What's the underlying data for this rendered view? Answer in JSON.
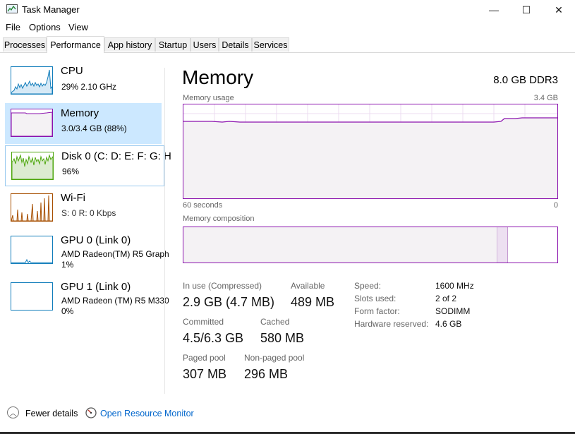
{
  "window": {
    "title": "Task Manager",
    "controls": {
      "minimize": "—",
      "maximize": "☐",
      "close": "✕"
    }
  },
  "menu": [
    "File",
    "Options",
    "View"
  ],
  "tabs": [
    "Processes",
    "Performance",
    "App history",
    "Startup",
    "Users",
    "Details",
    "Services"
  ],
  "active_tab": "Performance",
  "sidebar": {
    "items": [
      {
        "title": "CPU",
        "line1": "29%  2.10 GHz",
        "line2": "",
        "color": "#117dbb"
      },
      {
        "title": "Memory",
        "line1": "3.0/3.4 GB (88%)",
        "line2": "",
        "color": "#8b12ae"
      },
      {
        "title": "Disk 0 (C: D: E: F: G: H",
        "line1": "96%",
        "line2": "",
        "color": "#4da60c"
      },
      {
        "title": "Wi-Fi",
        "line1": "S: 0 R: 0 Kbps",
        "line2": "",
        "color": "#a74f01"
      },
      {
        "title": "GPU 0 (Link 0)",
        "line1": "AMD Radeon(TM) R5 Graph",
        "line2": "1%",
        "color": "#117dbb"
      },
      {
        "title": "GPU 1 (Link 0)",
        "line1": "AMD Radeon (TM) R5 M330",
        "line2": "0%",
        "color": "#117dbb"
      }
    ]
  },
  "main": {
    "title": "Memory",
    "spec": "8.0 GB DDR3",
    "usage_label": "Memory usage",
    "usage_max": "3.4 GB",
    "time_left": "60 seconds",
    "time_right": "0",
    "composition_label": "Memory composition",
    "stats": {
      "in_use_label": "In use (Compressed)",
      "in_use_value": "2.9 GB (4.7 MB)",
      "available_label": "Available",
      "available_value": "489 MB",
      "committed_label": "Committed",
      "committed_value": "4.5/6.3 GB",
      "cached_label": "Cached",
      "cached_value": "580 MB",
      "paged_label": "Paged pool",
      "paged_value": "307 MB",
      "nonpaged_label": "Non-paged pool",
      "nonpaged_value": "296 MB"
    },
    "details": [
      {
        "label": "Speed:",
        "value": "1600 MHz"
      },
      {
        "label": "Slots used:",
        "value": "2 of 2"
      },
      {
        "label": "Form factor:",
        "value": "SODIMM"
      },
      {
        "label": "Hardware reserved:",
        "value": "4.6 GB"
      }
    ]
  },
  "footer": {
    "fewer_details": "Fewer details",
    "open_monitor": "Open Resource Monitor"
  }
}
